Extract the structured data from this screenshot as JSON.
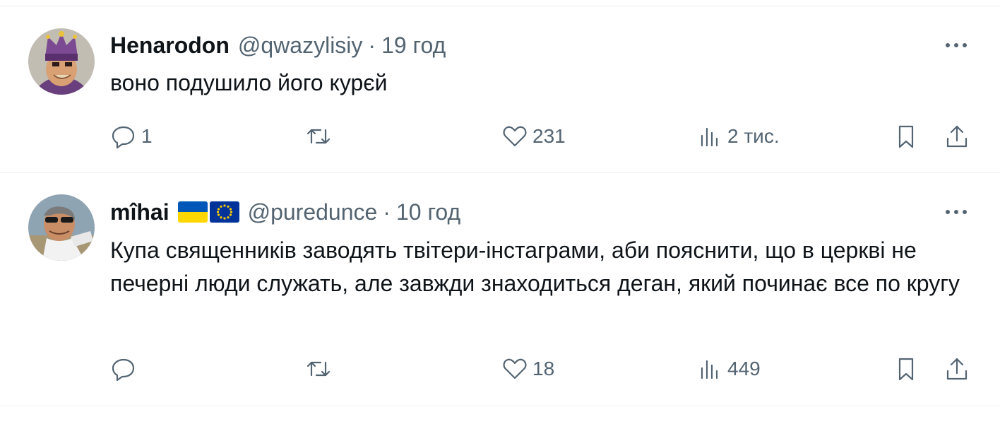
{
  "tweets": [
    {
      "author_name": "Henarodon",
      "handle": "@qwazylisiy",
      "separator": "·",
      "time": "19 год",
      "text": "воно подушило його курєй",
      "replies": "1",
      "retweets": "",
      "likes": "231",
      "views": "2 тис.",
      "avatar_icon": "jester-avatar"
    },
    {
      "author_name": "mîhai",
      "flags": [
        "ukraine-flag-icon",
        "eu-flag-icon"
      ],
      "handle": "@puredunce",
      "separator": "·",
      "time": "10 год",
      "text": "Купа священників заводять твітери-інстаграми, аби пояснити, що в церкві не печерні люди служать, але завжди знаходиться деган, який починає все по кругу",
      "replies": "",
      "retweets": "",
      "likes": "18",
      "views": "449",
      "avatar_icon": "sunglasses-man-avatar"
    }
  ],
  "colors": {
    "text": "#0f1419",
    "secondary": "#536471",
    "divider": "#eff3f4",
    "ukraine_blue": "#0057b7",
    "ukraine_yellow": "#ffd700",
    "eu_blue": "#003399",
    "eu_stars": "#ffcc00"
  }
}
